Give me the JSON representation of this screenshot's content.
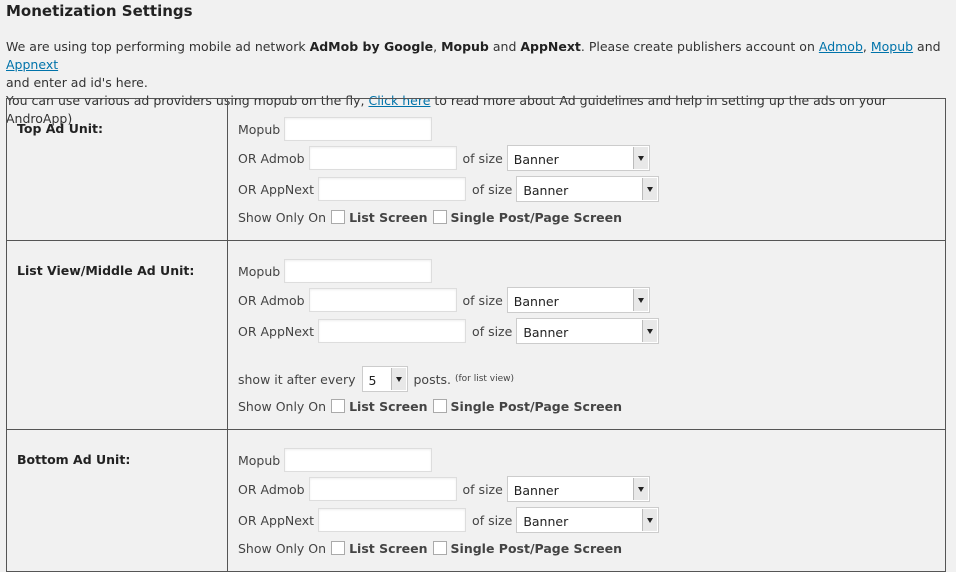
{
  "page": {
    "title": "Monetization Settings",
    "intro": {
      "p1_a": "We are using top performing mobile ad network ",
      "p1_b1": "AdMob by Google",
      "p1_c": ", ",
      "p1_b2": "Mopub",
      "p1_d": " and ",
      "p1_b3": "AppNext",
      "p1_e": ". Please create publishers account on ",
      "link_admob": "Admob",
      "sep1": ", ",
      "link_mopub": "Mopub",
      "sep2": " and ",
      "link_appnext": "Appnext",
      "p1_f": "and enter ad id's here.",
      "p2_a": "You can use various ad providers using mopub on the fly, ",
      "link_click": "Click here",
      "p2_b": " to read more about Ad guidelines and help in setting up the ads on your AndroApp)"
    }
  },
  "common": {
    "mopub_label": "Mopub",
    "admob_label": "OR Admob",
    "appnext_label": "OR AppNext",
    "of_size": "of size",
    "show_only_on": "Show Only On",
    "list_screen": "List Screen",
    "single_post": "Single Post/Page Screen"
  },
  "units": {
    "top": {
      "label": "Top Ad Unit:",
      "admob_size": "Banner",
      "appnext_size": "Banner"
    },
    "middle": {
      "label": "List View/Middle Ad Unit:",
      "admob_size": "Banner",
      "appnext_size": "Banner",
      "show_after_label": "show it after every",
      "show_after_value": "5",
      "posts_label": "posts.",
      "posts_note": "(for list view)"
    },
    "bottom": {
      "label": "Bottom Ad Unit:",
      "admob_size": "Banner",
      "appnext_size": "Banner"
    }
  }
}
